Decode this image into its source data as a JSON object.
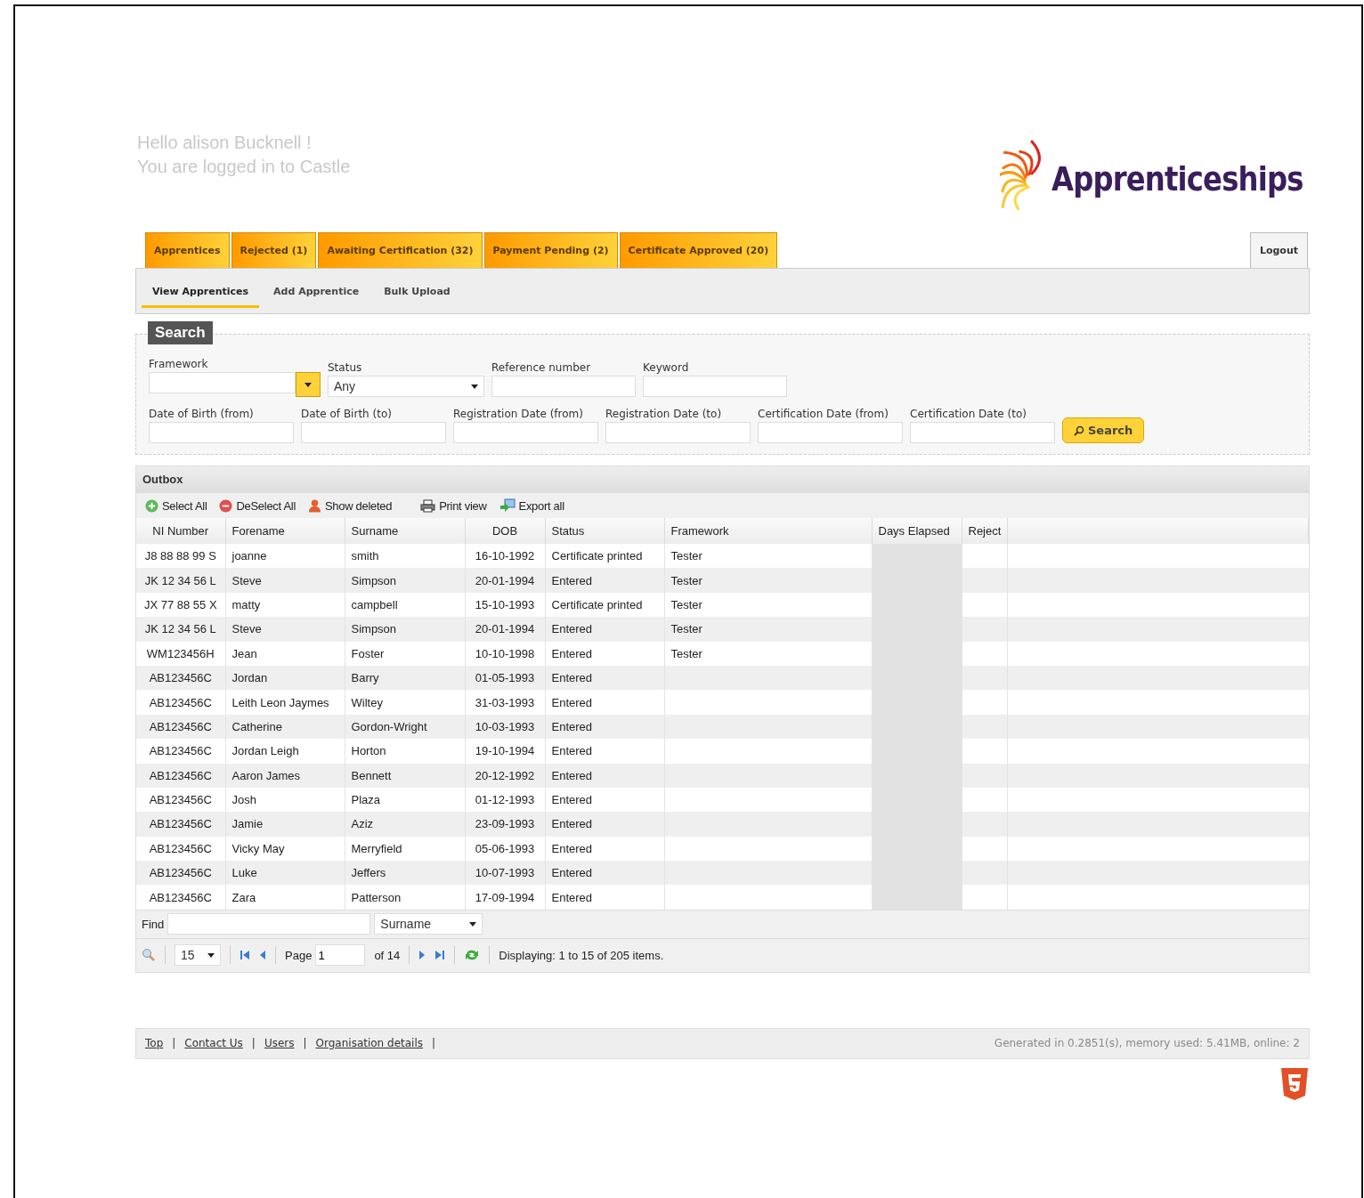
{
  "greeting": [
    "Hello alison Bucknell !",
    "You are logged in to Castle"
  ],
  "logo": {
    "text": "Apprenticeships"
  },
  "tabs": [
    "Apprentices",
    "Rejected (1)",
    "Awaiting Certification (32)",
    "Payment Pending (2)",
    "Certificate Approved (20)"
  ],
  "logout": "Logout",
  "subtabs": [
    {
      "label": "View Apprentices",
      "selected": true
    },
    {
      "label": "Add Apprentice",
      "selected": false
    },
    {
      "label": "Bulk Upload",
      "selected": false
    }
  ],
  "search": {
    "title": "Search",
    "row_1": [
      {
        "label": "Framework",
        "kind": "combo"
      },
      {
        "label": "Status",
        "kind": "select",
        "value": "Any"
      },
      {
        "label": "Reference number",
        "kind": "text"
      },
      {
        "label": "Keyword",
        "kind": "text"
      }
    ],
    "row_2": [
      {
        "label": "Date of Birth (from)",
        "kind": "text"
      },
      {
        "label": "Date of Birth (to)",
        "kind": "text"
      },
      {
        "label": "Registration Date (from)",
        "kind": "text"
      },
      {
        "label": "Registration Date (to)",
        "kind": "text"
      },
      {
        "label": "Certification Date (from)",
        "kind": "text"
      },
      {
        "label": "Certification Date (to)",
        "kind": "text"
      }
    ],
    "button": "Search"
  },
  "outbox": {
    "title": "Outbox",
    "toolbar": [
      {
        "label": "Select All",
        "kind": "add"
      },
      {
        "label": "DeSelect All",
        "kind": "remove"
      },
      {
        "label": "Show deleted",
        "kind": "person"
      },
      {
        "label": "Print view",
        "kind": "print"
      },
      {
        "label": "Export all",
        "kind": "export"
      }
    ],
    "columns": [
      "NI Number",
      "Forename",
      "Surname",
      "DOB",
      "Status",
      "Framework",
      "Days Elapsed",
      "Reject"
    ],
    "rows": [
      [
        "J8 88 88 99 S",
        "joanne",
        "smith",
        "16-10-1992",
        "Certificate printed",
        "Tester"
      ],
      [
        "JK 12 34 56 L",
        "Steve",
        "Simpson",
        "20-01-1994",
        "Entered",
        "Tester"
      ],
      [
        "JX 77 88 55 X",
        "matty",
        "campbell",
        "15-10-1993",
        "Certificate printed",
        "Tester"
      ],
      [
        "JK 12 34 56 L",
        "Steve",
        "Simpson",
        "20-01-1994",
        "Entered",
        "Tester"
      ],
      [
        "WM123456H",
        "Jean",
        "Foster",
        "10-10-1998",
        "Entered",
        "Tester"
      ],
      [
        "AB123456C",
        "Jordan",
        "Barry",
        "01-05-1993",
        "Entered"
      ],
      [
        "AB123456C",
        "Leith Leon Jaymes",
        "Wiltey",
        "31-03-1993",
        "Entered"
      ],
      [
        "AB123456C",
        "Catherine",
        "Gordon-Wright",
        "10-03-1993",
        "Entered"
      ],
      [
        "AB123456C",
        "Jordan Leigh",
        "Horton",
        "19-10-1994",
        "Entered"
      ],
      [
        "AB123456C",
        "Aaron James",
        "Bennett",
        "20-12-1992",
        "Entered"
      ],
      [
        "AB123456C",
        "Josh",
        "Plaza",
        "01-12-1993",
        "Entered"
      ],
      [
        "AB123456C",
        "Jamie",
        "Aziz",
        "23-09-1993",
        "Entered"
      ],
      [
        "AB123456C",
        "Vicky May",
        "Merryfield",
        "05-06-1993",
        "Entered"
      ],
      [
        "AB123456C",
        "Luke",
        "Jeffers",
        "10-07-1993",
        "Entered"
      ],
      [
        "AB123456C",
        "Zara",
        "Patterson",
        "17-09-1994",
        "Entered"
      ]
    ],
    "find": {
      "label": "Find",
      "field": "Surname"
    },
    "pager": {
      "page_size": "15",
      "page_label": "Page",
      "page": "1",
      "of": "of 14",
      "display": "Displaying: 1 to 15 of 205 items."
    }
  },
  "footer": {
    "links": [
      "Top",
      "Contact Us",
      "Users",
      "Organisation details"
    ],
    "separator": "|",
    "stats": "Generated in 0.2851(s), memory used: 5.41MB, online: 2"
  }
}
